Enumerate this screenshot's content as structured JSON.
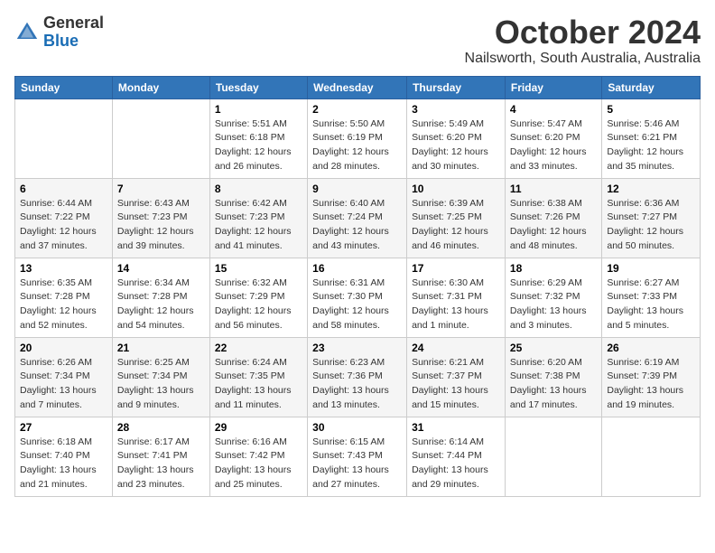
{
  "header": {
    "logo_general": "General",
    "logo_blue": "Blue",
    "month_title": "October 2024",
    "location": "Nailsworth, South Australia, Australia"
  },
  "days_of_week": [
    "Sunday",
    "Monday",
    "Tuesday",
    "Wednesday",
    "Thursday",
    "Friday",
    "Saturday"
  ],
  "weeks": [
    [
      {
        "day": "",
        "sunrise": "",
        "sunset": "",
        "daylight": ""
      },
      {
        "day": "",
        "sunrise": "",
        "sunset": "",
        "daylight": ""
      },
      {
        "day": "1",
        "sunrise": "Sunrise: 5:51 AM",
        "sunset": "Sunset: 6:18 PM",
        "daylight": "Daylight: 12 hours and 26 minutes."
      },
      {
        "day": "2",
        "sunrise": "Sunrise: 5:50 AM",
        "sunset": "Sunset: 6:19 PM",
        "daylight": "Daylight: 12 hours and 28 minutes."
      },
      {
        "day": "3",
        "sunrise": "Sunrise: 5:49 AM",
        "sunset": "Sunset: 6:20 PM",
        "daylight": "Daylight: 12 hours and 30 minutes."
      },
      {
        "day": "4",
        "sunrise": "Sunrise: 5:47 AM",
        "sunset": "Sunset: 6:20 PM",
        "daylight": "Daylight: 12 hours and 33 minutes."
      },
      {
        "day": "5",
        "sunrise": "Sunrise: 5:46 AM",
        "sunset": "Sunset: 6:21 PM",
        "daylight": "Daylight: 12 hours and 35 minutes."
      }
    ],
    [
      {
        "day": "6",
        "sunrise": "Sunrise: 6:44 AM",
        "sunset": "Sunset: 7:22 PM",
        "daylight": "Daylight: 12 hours and 37 minutes."
      },
      {
        "day": "7",
        "sunrise": "Sunrise: 6:43 AM",
        "sunset": "Sunset: 7:23 PM",
        "daylight": "Daylight: 12 hours and 39 minutes."
      },
      {
        "day": "8",
        "sunrise": "Sunrise: 6:42 AM",
        "sunset": "Sunset: 7:23 PM",
        "daylight": "Daylight: 12 hours and 41 minutes."
      },
      {
        "day": "9",
        "sunrise": "Sunrise: 6:40 AM",
        "sunset": "Sunset: 7:24 PM",
        "daylight": "Daylight: 12 hours and 43 minutes."
      },
      {
        "day": "10",
        "sunrise": "Sunrise: 6:39 AM",
        "sunset": "Sunset: 7:25 PM",
        "daylight": "Daylight: 12 hours and 46 minutes."
      },
      {
        "day": "11",
        "sunrise": "Sunrise: 6:38 AM",
        "sunset": "Sunset: 7:26 PM",
        "daylight": "Daylight: 12 hours and 48 minutes."
      },
      {
        "day": "12",
        "sunrise": "Sunrise: 6:36 AM",
        "sunset": "Sunset: 7:27 PM",
        "daylight": "Daylight: 12 hours and 50 minutes."
      }
    ],
    [
      {
        "day": "13",
        "sunrise": "Sunrise: 6:35 AM",
        "sunset": "Sunset: 7:28 PM",
        "daylight": "Daylight: 12 hours and 52 minutes."
      },
      {
        "day": "14",
        "sunrise": "Sunrise: 6:34 AM",
        "sunset": "Sunset: 7:28 PM",
        "daylight": "Daylight: 12 hours and 54 minutes."
      },
      {
        "day": "15",
        "sunrise": "Sunrise: 6:32 AM",
        "sunset": "Sunset: 7:29 PM",
        "daylight": "Daylight: 12 hours and 56 minutes."
      },
      {
        "day": "16",
        "sunrise": "Sunrise: 6:31 AM",
        "sunset": "Sunset: 7:30 PM",
        "daylight": "Daylight: 12 hours and 58 minutes."
      },
      {
        "day": "17",
        "sunrise": "Sunrise: 6:30 AM",
        "sunset": "Sunset: 7:31 PM",
        "daylight": "Daylight: 13 hours and 1 minute."
      },
      {
        "day": "18",
        "sunrise": "Sunrise: 6:29 AM",
        "sunset": "Sunset: 7:32 PM",
        "daylight": "Daylight: 13 hours and 3 minutes."
      },
      {
        "day": "19",
        "sunrise": "Sunrise: 6:27 AM",
        "sunset": "Sunset: 7:33 PM",
        "daylight": "Daylight: 13 hours and 5 minutes."
      }
    ],
    [
      {
        "day": "20",
        "sunrise": "Sunrise: 6:26 AM",
        "sunset": "Sunset: 7:34 PM",
        "daylight": "Daylight: 13 hours and 7 minutes."
      },
      {
        "day": "21",
        "sunrise": "Sunrise: 6:25 AM",
        "sunset": "Sunset: 7:34 PM",
        "daylight": "Daylight: 13 hours and 9 minutes."
      },
      {
        "day": "22",
        "sunrise": "Sunrise: 6:24 AM",
        "sunset": "Sunset: 7:35 PM",
        "daylight": "Daylight: 13 hours and 11 minutes."
      },
      {
        "day": "23",
        "sunrise": "Sunrise: 6:23 AM",
        "sunset": "Sunset: 7:36 PM",
        "daylight": "Daylight: 13 hours and 13 minutes."
      },
      {
        "day": "24",
        "sunrise": "Sunrise: 6:21 AM",
        "sunset": "Sunset: 7:37 PM",
        "daylight": "Daylight: 13 hours and 15 minutes."
      },
      {
        "day": "25",
        "sunrise": "Sunrise: 6:20 AM",
        "sunset": "Sunset: 7:38 PM",
        "daylight": "Daylight: 13 hours and 17 minutes."
      },
      {
        "day": "26",
        "sunrise": "Sunrise: 6:19 AM",
        "sunset": "Sunset: 7:39 PM",
        "daylight": "Daylight: 13 hours and 19 minutes."
      }
    ],
    [
      {
        "day": "27",
        "sunrise": "Sunrise: 6:18 AM",
        "sunset": "Sunset: 7:40 PM",
        "daylight": "Daylight: 13 hours and 21 minutes."
      },
      {
        "day": "28",
        "sunrise": "Sunrise: 6:17 AM",
        "sunset": "Sunset: 7:41 PM",
        "daylight": "Daylight: 13 hours and 23 minutes."
      },
      {
        "day": "29",
        "sunrise": "Sunrise: 6:16 AM",
        "sunset": "Sunset: 7:42 PM",
        "daylight": "Daylight: 13 hours and 25 minutes."
      },
      {
        "day": "30",
        "sunrise": "Sunrise: 6:15 AM",
        "sunset": "Sunset: 7:43 PM",
        "daylight": "Daylight: 13 hours and 27 minutes."
      },
      {
        "day": "31",
        "sunrise": "Sunrise: 6:14 AM",
        "sunset": "Sunset: 7:44 PM",
        "daylight": "Daylight: 13 hours and 29 minutes."
      },
      {
        "day": "",
        "sunrise": "",
        "sunset": "",
        "daylight": ""
      },
      {
        "day": "",
        "sunrise": "",
        "sunset": "",
        "daylight": ""
      }
    ]
  ]
}
